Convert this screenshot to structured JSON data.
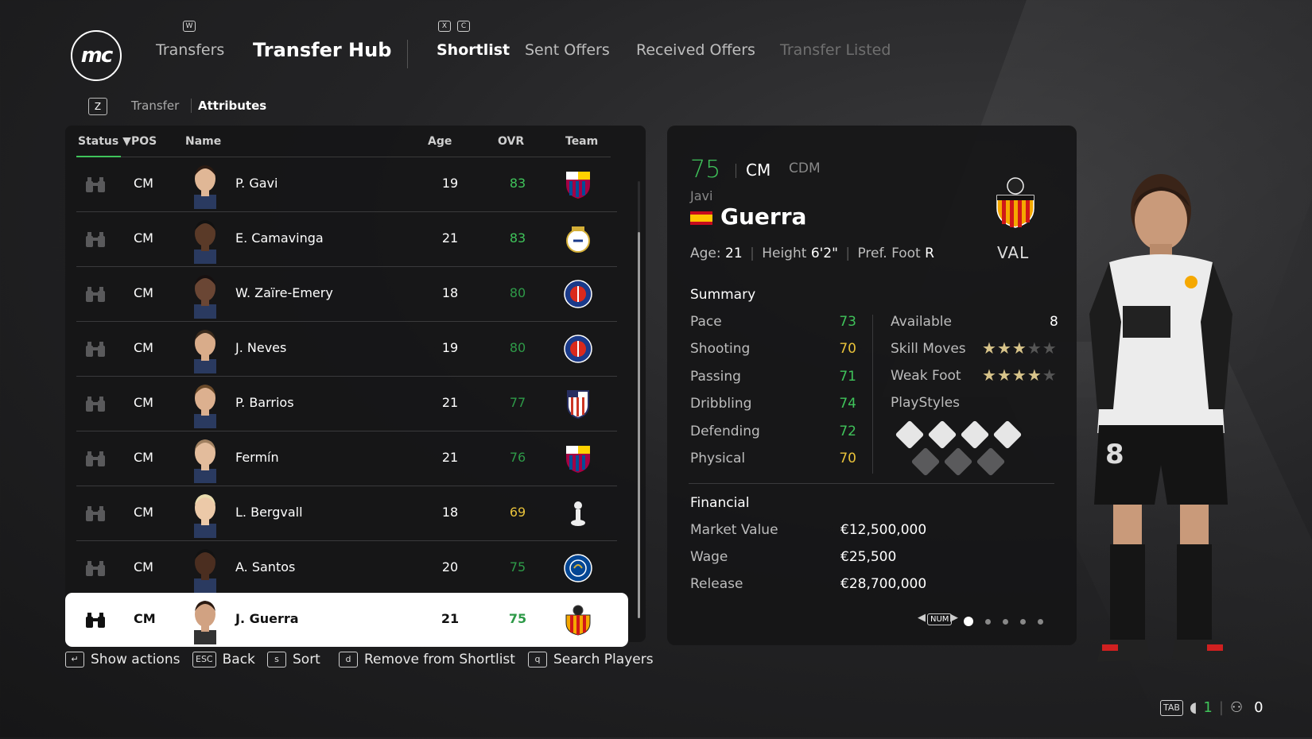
{
  "nav": {
    "key_w": "W",
    "key_x": "X",
    "key_c": "C",
    "logo": "mc",
    "transfers": "Transfers",
    "transfer_hub": "Transfer Hub",
    "shortlist": "Shortlist",
    "sent_offers": "Sent Offers",
    "received_offers": "Received Offers",
    "transfer_listed": "Transfer Listed"
  },
  "subnav": {
    "key": "Z",
    "transfer": "Transfer",
    "attributes": "Attributes"
  },
  "table": {
    "headers": {
      "status": "Status ▼",
      "pos": "POS",
      "name": "Name",
      "age": "Age",
      "ovr": "OVR",
      "team": "Team"
    },
    "rows": [
      {
        "pos": "CM",
        "name": "P. Gavi",
        "age": "19",
        "ovr": "83",
        "ovr_color": "#3fc35a",
        "team_icon": "barcelona-crest-icon"
      },
      {
        "pos": "CM",
        "name": "E. Camavinga",
        "age": "21",
        "ovr": "83",
        "ovr_color": "#3fc35a",
        "team_icon": "real-madrid-crest-icon"
      },
      {
        "pos": "CM",
        "name": "W. Zaïre-Emery",
        "age": "18",
        "ovr": "80",
        "ovr_color": "#2e9a48",
        "team_icon": "psg-crest-icon"
      },
      {
        "pos": "CM",
        "name": "J. Neves",
        "age": "19",
        "ovr": "80",
        "ovr_color": "#2e9a48",
        "team_icon": "psg-crest-icon"
      },
      {
        "pos": "CM",
        "name": "P. Barrios",
        "age": "21",
        "ovr": "77",
        "ovr_color": "#2e9a48",
        "team_icon": "atletico-crest-icon"
      },
      {
        "pos": "CM",
        "name": "Fermín",
        "age": "21",
        "ovr": "76",
        "ovr_color": "#2e9a48",
        "team_icon": "barcelona-crest-icon"
      },
      {
        "pos": "CM",
        "name": "L. Bergvall",
        "age": "18",
        "ovr": "69",
        "ovr_color": "#e8c23a",
        "team_icon": "tottenham-crest-icon"
      },
      {
        "pos": "CM",
        "name": "A. Santos",
        "age": "20",
        "ovr": "75",
        "ovr_color": "#2e9a48",
        "team_icon": "chelsea-crest-icon"
      },
      {
        "pos": "CM",
        "name": "J. Guerra",
        "age": "21",
        "ovr": "75",
        "ovr_color": "#2e9a48",
        "team_icon": "valencia-crest-icon"
      }
    ]
  },
  "footer": [
    {
      "key": "↵",
      "label": "Show actions"
    },
    {
      "key": "ESC",
      "label": "Back"
    },
    {
      "key": "s",
      "label": "Sort"
    },
    {
      "key": "d",
      "label": "Remove from Shortlist"
    },
    {
      "key": "q",
      "label": "Search Players"
    }
  ],
  "player": {
    "ovr": "75",
    "pos_primary": "CM",
    "pos_alt": "CDM",
    "first_name": "Javi",
    "last_name": "Guerra",
    "nation_icon": "spain-flag-icon",
    "club_abbr": "VAL",
    "age_label": "Age:",
    "age": "21",
    "height_label": "Height",
    "height": "6'2\"",
    "foot_label": "Pref. Foot",
    "foot": "R",
    "summary_title": "Summary",
    "stats": [
      {
        "label": "Pace",
        "value": "73",
        "color": "#3fc35a"
      },
      {
        "label": "Shooting",
        "value": "70",
        "color": "#e8c23a"
      },
      {
        "label": "Passing",
        "value": "71",
        "color": "#3fc35a"
      },
      {
        "label": "Dribbling",
        "value": "74",
        "color": "#3fc35a"
      },
      {
        "label": "Defending",
        "value": "72",
        "color": "#3fc35a"
      },
      {
        "label": "Physical",
        "value": "70",
        "color": "#e8c23a"
      }
    ],
    "available_label": "Available",
    "available": "8",
    "skill_moves_label": "Skill Moves",
    "skill_moves_rating": 3,
    "weak_foot_label": "Weak Foot",
    "weak_foot_rating": 4,
    "playstyles_label": "PlayStyles",
    "financial_title": "Financial",
    "market_value_label": "Market Value",
    "market_value": "€12,500,000",
    "wage_label": "Wage",
    "wage": "€25,500",
    "release_label": "Release",
    "release": "€28,700,000",
    "page_key": "NUM",
    "page_current": 1,
    "page_total": 5
  },
  "status_bar": {
    "tab_key": "TAB",
    "count_a": "1",
    "count_b": "0"
  }
}
